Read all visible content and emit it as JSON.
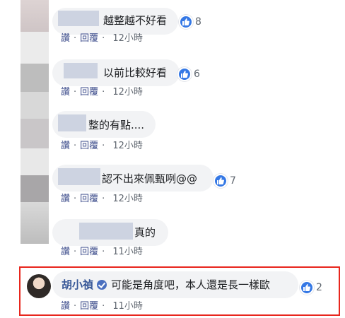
{
  "comments": [
    {
      "text": "越整越不好看",
      "reaction_count": "8",
      "reply_label": "回覆",
      "like_label": "讚",
      "time": "12小時"
    },
    {
      "text": "以前比較好看",
      "reaction_count": "6",
      "reply_label": "回覆",
      "like_label": "讚",
      "time": "12小時"
    },
    {
      "text": "整的有點....",
      "reaction_count": "",
      "reply_label": "回覆",
      "like_label": "讚",
      "time": "12小時"
    },
    {
      "text": "認不出來佩甄咧@@",
      "reaction_count": "7",
      "reply_label": "回覆",
      "like_label": "讚",
      "time": "12小時"
    },
    {
      "text": "真的",
      "reaction_count": "",
      "reply_label": "回覆",
      "like_label": "讚",
      "time": "11小時"
    },
    {
      "author": "胡小禎",
      "text": "可能是角度吧，本人還是長一樣歐",
      "reaction_count": "2",
      "reply_label": "回覆",
      "like_label": "讚",
      "time": "11小時"
    }
  ],
  "separator": "·",
  "colors": {
    "like_blue": "#3578e5",
    "highlight_red": "#e8261d",
    "bubble_bg": "#f2f3f5"
  },
  "icons": {
    "like": "thumbs-up-icon",
    "verified": "verified-badge-icon"
  }
}
